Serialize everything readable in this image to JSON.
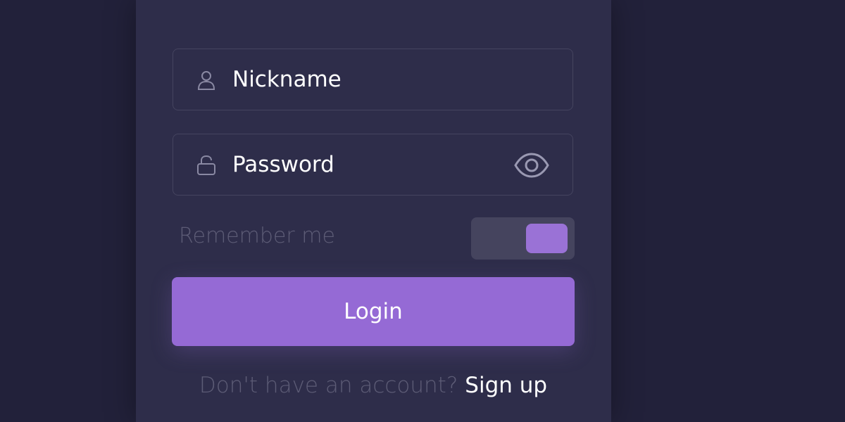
{
  "form": {
    "nickname": {
      "value": "",
      "placeholder": "Nickname",
      "icon": "user-icon"
    },
    "password": {
      "value": "",
      "placeholder": "Password",
      "icon": "unlock-icon",
      "toggle_icon": "eye-icon"
    },
    "remember": {
      "label": "Remember me",
      "enabled": true
    },
    "login_label": "Login",
    "signup_prompt": "Don't have an account?",
    "signup_link": "Sign up"
  },
  "colors": {
    "background": "#22213a",
    "card": "#2e2d4a",
    "accent": "#956ad5",
    "muted_text": "#5d5c76",
    "border": "#45445f"
  }
}
